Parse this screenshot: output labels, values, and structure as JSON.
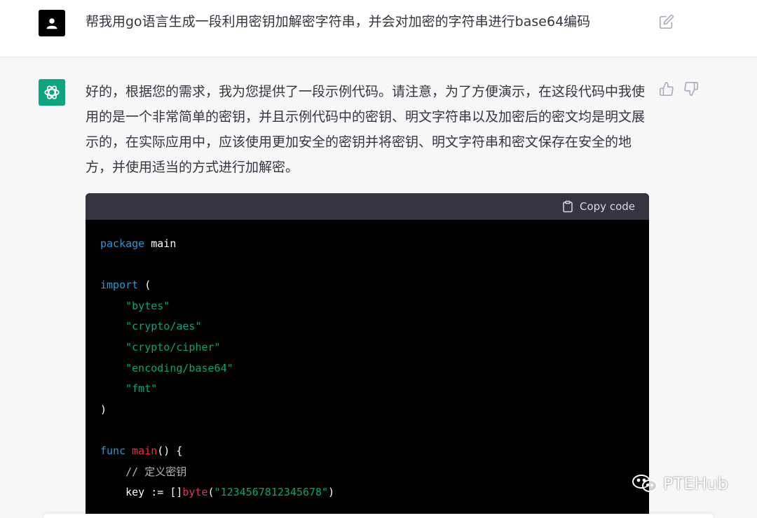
{
  "user_message": {
    "text": "帮我用go语言生成一段利用密钥加解密字符串，并会对加密的字符串进行base64编码"
  },
  "bot_message": {
    "paragraph": "好的，根据您的需求，我为您提供了一段示例代码。请注意，为了方便演示，在这段代码中我使用的是一个非常简单的密钥，并且示例代码中的密钥、明文字符串以及加密后的密文均是明文展示的，在实际应用中，应该使用更加安全的密钥并将密钥、明文字符串和密文保存在安全的地方，并使用适当的方式进行加解密。"
  },
  "code_block": {
    "copy_label": "Copy code",
    "tokens": {
      "package_kw": "package",
      "package_name": " main",
      "import_kw": "import",
      "import_open": " (",
      "imp1": "\"bytes\"",
      "imp2": "\"crypto/aes\"",
      "imp3": "\"crypto/cipher\"",
      "imp4": "\"encoding/base64\"",
      "imp5": "\"fmt\"",
      "import_close": ")",
      "func_kw": "func",
      "func_name": " main",
      "func_rest": "() {",
      "comment": "// 定义密钥",
      "key_lhs": "key := []",
      "key_type": "byte",
      "key_open": "(",
      "key_str": "\"1234567812345678\"",
      "key_close": ")"
    }
  },
  "watermark": {
    "text": "PTEHub"
  },
  "colors": {
    "keyword": "#2e95d3",
    "string": "#00a67d",
    "function": "#f22c3d",
    "type": "#df3079",
    "bot_avatar": "#10a37f"
  },
  "icons": [
    "user-icon",
    "openai-logo-icon",
    "edit-icon",
    "thumbs-up-icon",
    "thumbs-down-icon",
    "clipboard-icon",
    "wechat-icon"
  ]
}
